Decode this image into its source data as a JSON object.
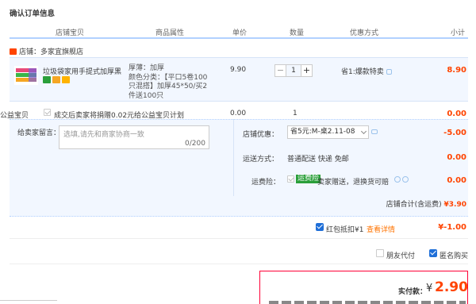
{
  "section_title": "确认订单信息",
  "columns": [
    "店铺宝贝",
    "商品属性",
    "单价",
    "数量",
    "优惠方式",
    "小计"
  ],
  "shop": {
    "label": "店铺：多家宜旗舰店"
  },
  "item": {
    "title": "垃圾袋家用手提式加厚黑...",
    "attrs": [
      "厚薄：加厚",
      "颜色分类：【平口5卷100",
      "只混搭】加厚45*50/买2",
      "件送100只"
    ],
    "price": "9.90",
    "quantity": "1",
    "minus_label": "−",
    "plus_label": "+",
    "promo": "省1:爆款特卖",
    "subtotal": "8.90"
  },
  "charity": {
    "label": "公益宝贝",
    "text": "成交后卖家将捐赠0.02元给公益宝贝计划",
    "price": "0.00",
    "qty": "1",
    "subtotal": "0.00"
  },
  "message": {
    "label": "给卖家留言：",
    "placeholder": "选填,请先和商家协商一致",
    "count": "0/200"
  },
  "coupon": {
    "label": "店铺优惠：",
    "selected": "省5元:M-桌2.11-08",
    "value": "-5.00"
  },
  "shipping": {
    "label": "运送方式：",
    "value": "普通配送 快递 免邮",
    "price": "0.00"
  },
  "insurance": {
    "label": "运费险：",
    "tag": "运费险",
    "text": "卖家赠送，退换货可赔",
    "price": "0.00"
  },
  "shop_total": {
    "label": "店铺合计(含运费)",
    "amount": "¥3.90"
  },
  "red_packet": {
    "label": "红包抵扣¥1",
    "link": "查看详情",
    "value": "¥-1.00"
  },
  "options": {
    "friend_pay": "朋友代付",
    "anonymous": "匿名购买"
  },
  "payment": {
    "label": "实付款：",
    "currency": "¥",
    "amount": "2.90"
  },
  "colors": {
    "accent": "#ff4400",
    "brand_blue": "#1f6fd8",
    "row_bg": "#f2f7ff",
    "pay_border": "#ff0036"
  }
}
